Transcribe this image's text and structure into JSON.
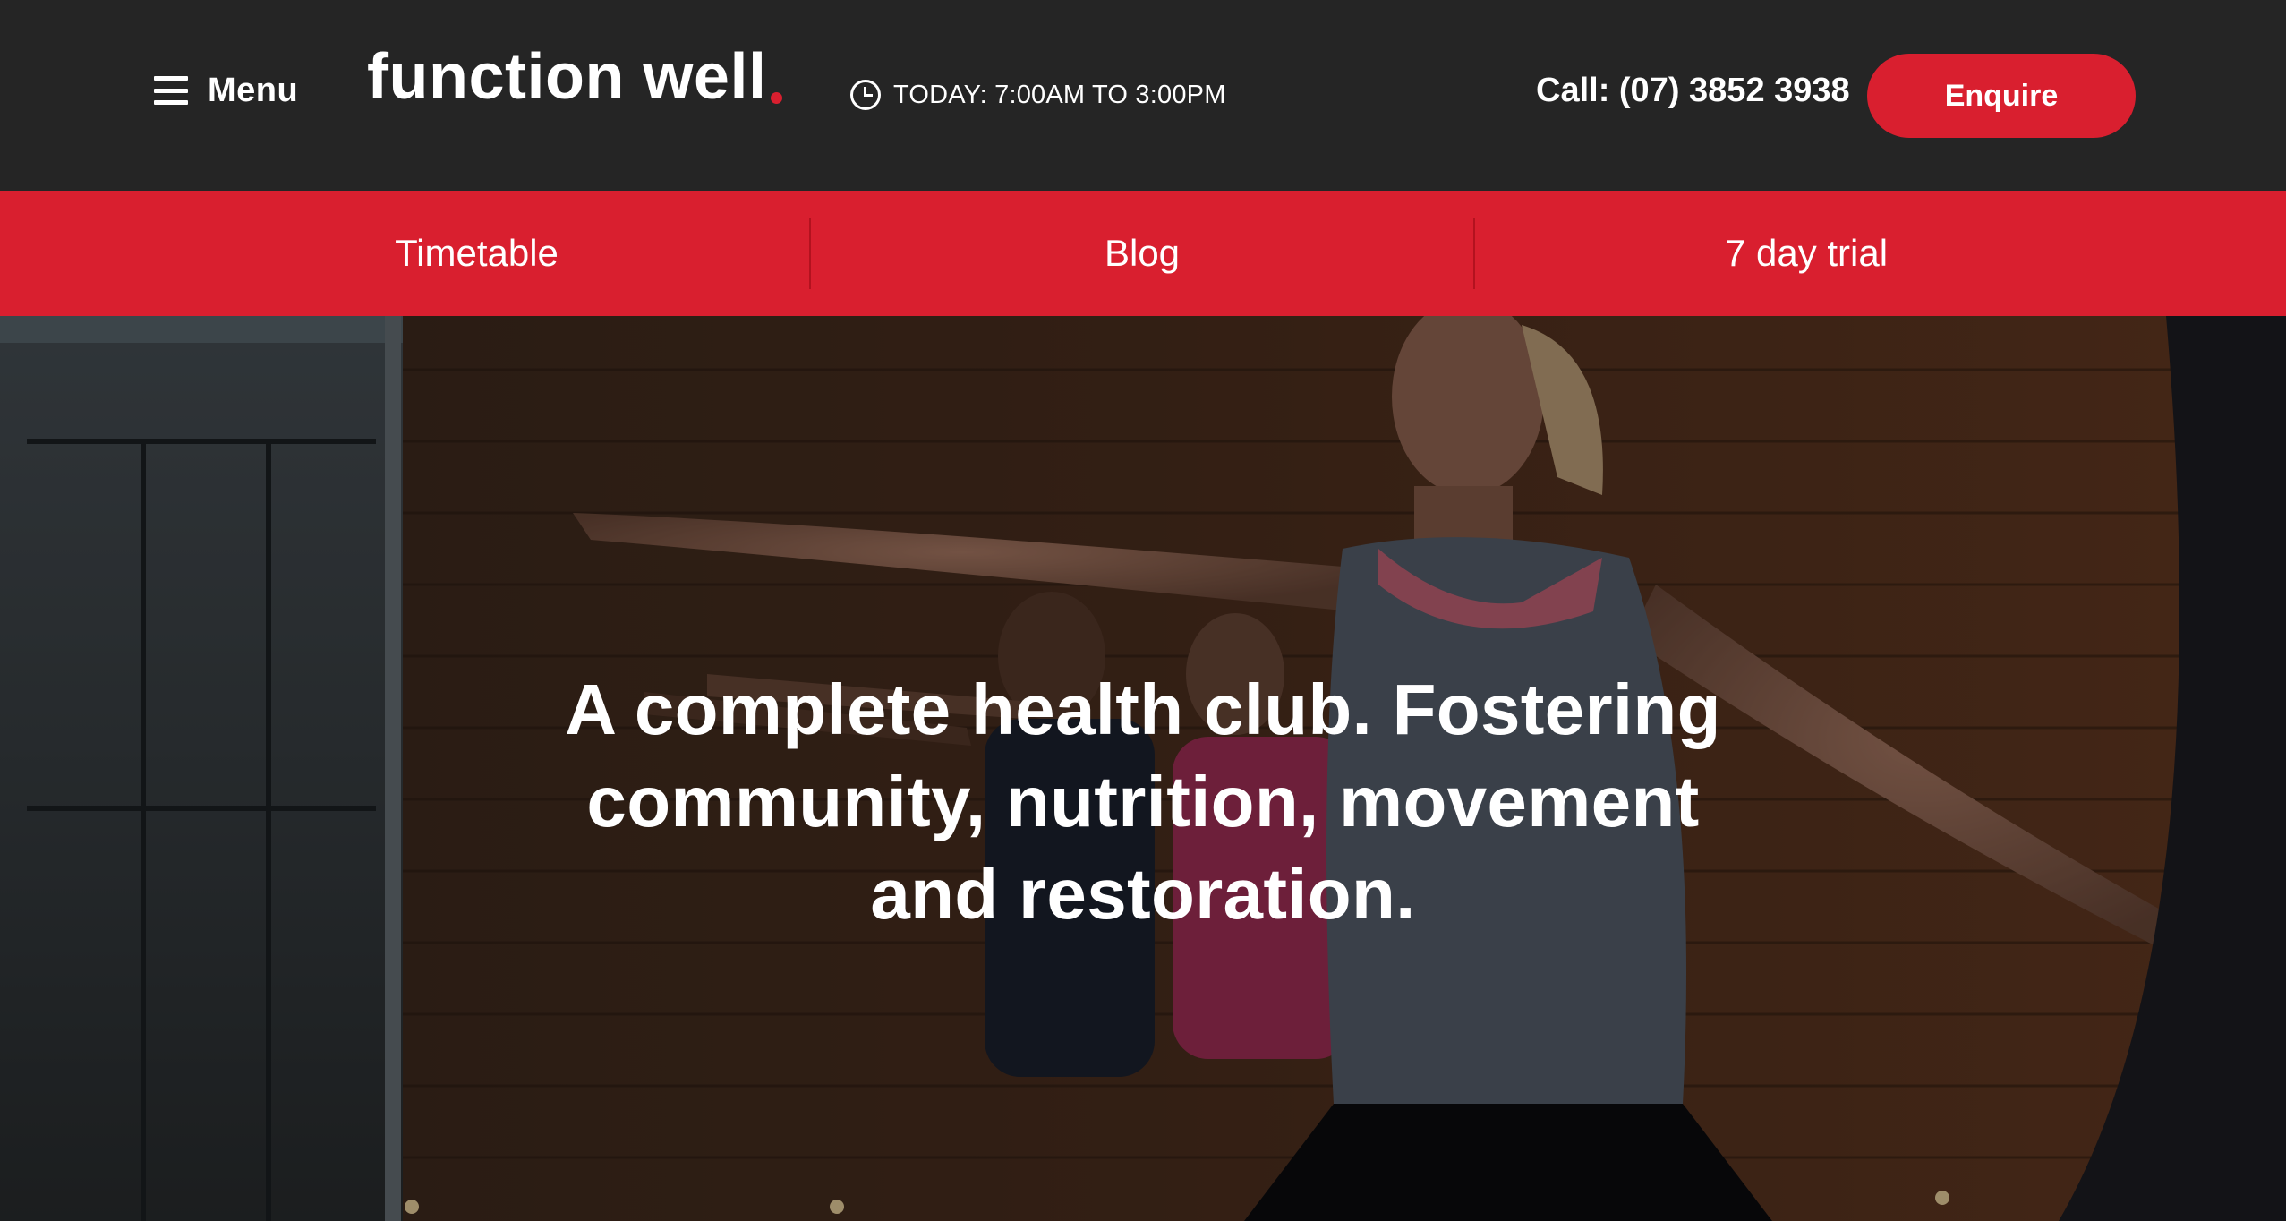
{
  "header": {
    "menu_label": "Menu",
    "menu_icon": "hamburger-icon",
    "logo_text": "function well",
    "hours_icon": "clock-icon",
    "hours_text": "TODAY: 7:00AM TO 3:00PM",
    "phone_text": "Call: (07) 3852 3938",
    "enquire_label": "Enquire"
  },
  "subnav": {
    "items": [
      {
        "label": "Timetable"
      },
      {
        "label": "Blog"
      },
      {
        "label": "7 day trial"
      }
    ]
  },
  "hero": {
    "headline": "A complete health club. Fostering community, nutrition, movement and restoration."
  },
  "colors": {
    "header_bg": "#252525",
    "accent": "#d91f2f",
    "text": "#ffffff"
  }
}
